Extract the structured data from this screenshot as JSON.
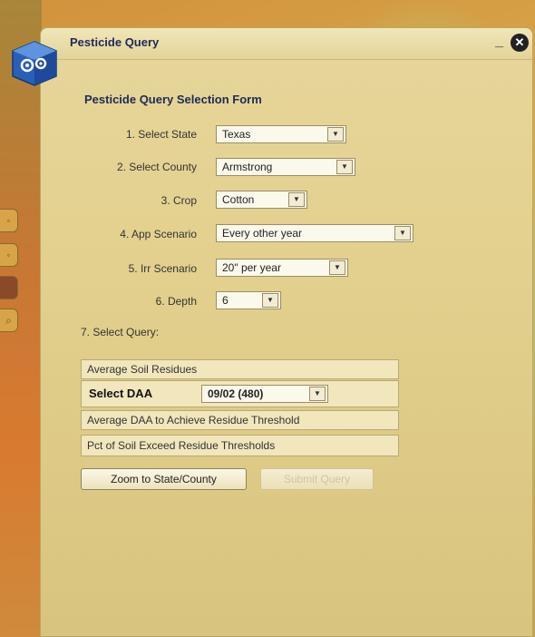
{
  "window": {
    "title": "Pesticide Query"
  },
  "form": {
    "title": "Pesticide Query Selection Form",
    "fields": [
      {
        "label": "1. Select State",
        "value": "Texas"
      },
      {
        "label": "2. Select County",
        "value": "Armstrong"
      },
      {
        "label": "3. Crop",
        "value": "Cotton"
      },
      {
        "label": "4. App Scenario",
        "value": "Every other year"
      },
      {
        "label": "5. Irr Scenario",
        "value": "20\" per year"
      },
      {
        "label": "6. Depth",
        "value": "6"
      }
    ],
    "query_label": "7. Select Query:",
    "queries": {
      "q1": "Average Soil Residues",
      "daa_label": "Select DAA",
      "daa_value": "09/02 (480)",
      "q2": "Average DAA to Achieve Residue Threshold",
      "q3": "Pct of Soil Exceed Residue Thresholds"
    },
    "buttons": {
      "zoom": "Zoom to State/County",
      "submit": "Submit Query"
    }
  },
  "icons": {
    "app": "gears-cube-icon",
    "minimize": "minimize-icon",
    "close": "close-icon",
    "dropdown": "chevron-down-icon"
  }
}
